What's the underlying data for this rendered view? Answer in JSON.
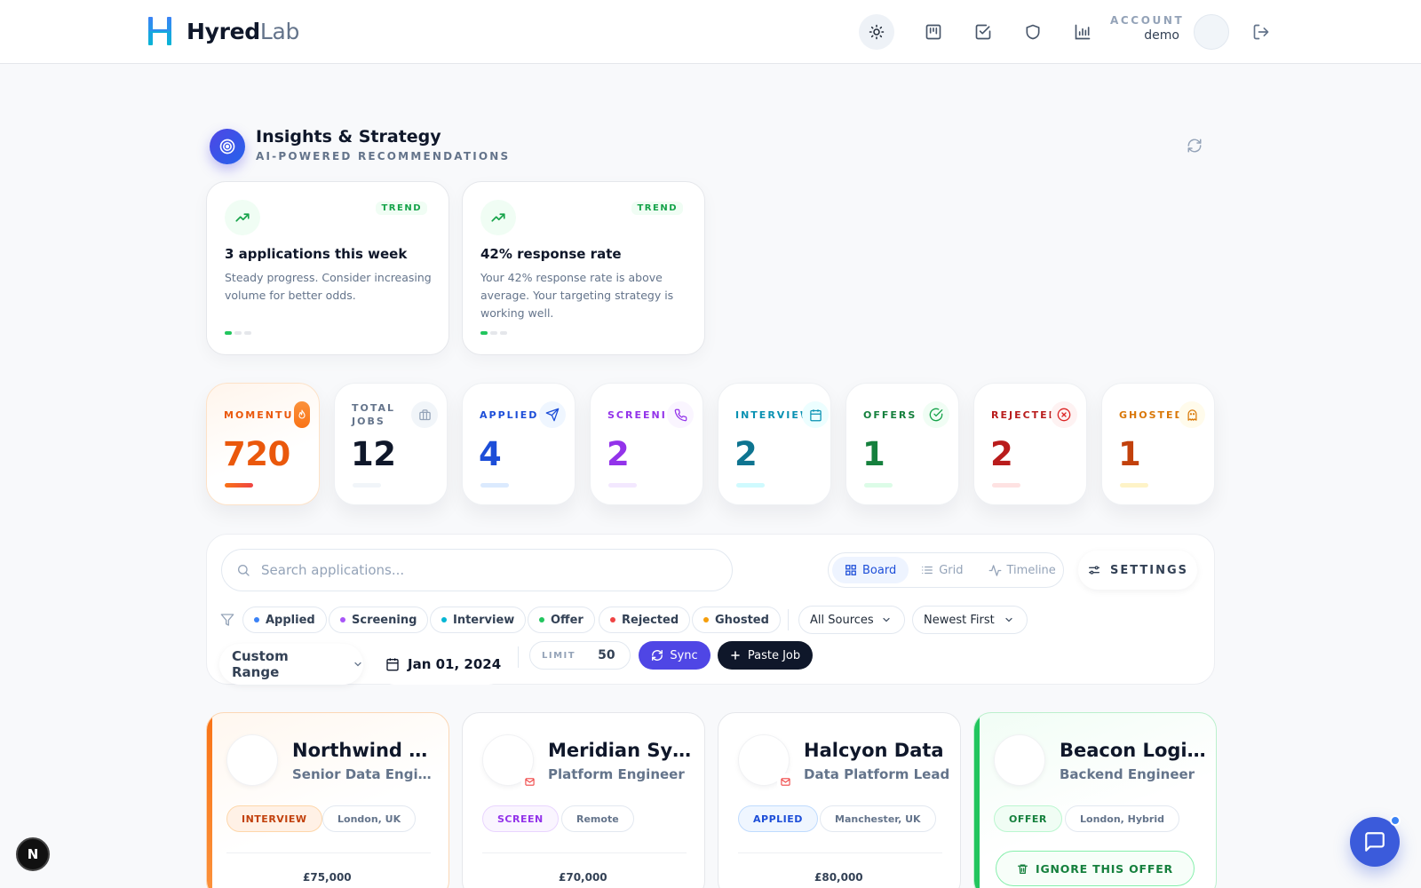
{
  "brand": {
    "name_bold": "Hyred",
    "name_light": "Lab"
  },
  "nav": {
    "icons": [
      "sun-icon",
      "board-icon",
      "checklist-icon",
      "shield-icon",
      "bar-chart-icon"
    ],
    "account_label": "ACCOUNT",
    "account_user": "demo"
  },
  "insights": {
    "title": "Insights & Strategy",
    "subtitle": "AI-POWERED RECOMMENDATIONS",
    "cards": [
      {
        "tag": "TREND",
        "title": "3 applications this week",
        "body": "Steady progress. Consider increasing volume for better odds."
      },
      {
        "tag": "TREND",
        "title": "42% response rate",
        "body": "Your 42% response rate is above average. Your targeting strategy is working well."
      }
    ]
  },
  "stats": [
    {
      "label": "MOMENTUM",
      "value": "720",
      "color": "#ea580c"
    },
    {
      "label": "TOTAL JOBS",
      "value": "12",
      "color": "#0f172a"
    },
    {
      "label": "APPLIED",
      "value": "4",
      "color": "#1d4ed8"
    },
    {
      "label": "SCREENING",
      "value": "2",
      "color": "#9333ea"
    },
    {
      "label": "INTERVIEWS",
      "value": "2",
      "color": "#0e7490"
    },
    {
      "label": "OFFERS",
      "value": "1",
      "color": "#15803d"
    },
    {
      "label": "REJECTED",
      "value": "2",
      "color": "#b91c1c"
    },
    {
      "label": "GHOSTED",
      "value": "1",
      "color": "#c2410c"
    }
  ],
  "toolbar": {
    "search_placeholder": "Search applications...",
    "views": [
      "Board",
      "Grid",
      "Timeline"
    ],
    "settings_label": "SETTINGS",
    "filters": [
      "Applied",
      "Screening",
      "Interview",
      "Offer",
      "Rejected",
      "Ghosted"
    ],
    "sources": "All Sources",
    "sort": "Newest First",
    "range": "Custom Range",
    "date": "Jan 01, 2024",
    "limit_label": "LIMIT",
    "limit_value": "50",
    "sync_label": "Sync",
    "paste_label": "Paste Job"
  },
  "jobs": [
    {
      "company": "Northwind Analytics",
      "role": "Senior Data Engineer",
      "status": "INTERVIEW",
      "location": "London, UK",
      "salary": "£75,000"
    },
    {
      "company": "Meridian Systems",
      "role": "Platform Engineer",
      "status": "SCREEN",
      "location": "Remote",
      "salary": "£70,000"
    },
    {
      "company": "Halcyon Data",
      "role": "Data Platform Lead",
      "status": "APPLIED",
      "location": "Manchester, UK",
      "salary": "£80,000"
    },
    {
      "company": "Beacon Logistics",
      "role": "Backend Engineer",
      "status": "OFFER",
      "location": "London, Hybrid",
      "action": "IGNORE THIS OFFER"
    }
  ],
  "next_badge": "N"
}
